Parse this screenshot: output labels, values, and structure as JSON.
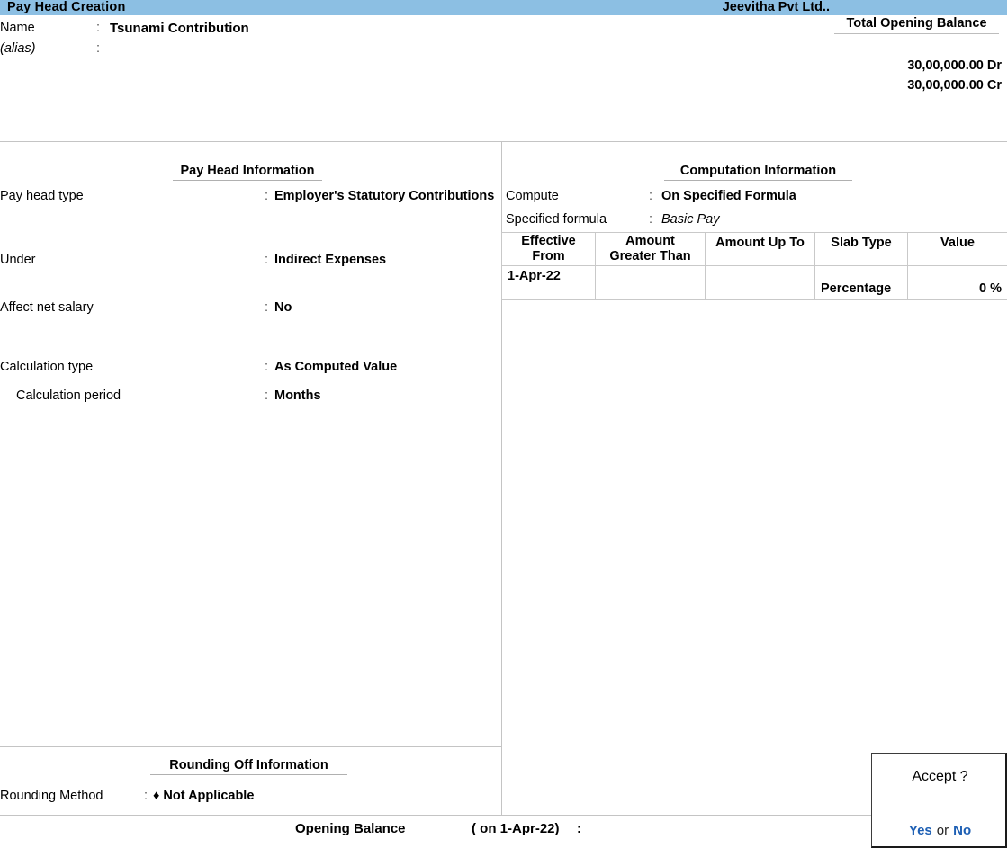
{
  "titlebar": {
    "screen_title": "Pay Head  Creation",
    "company_name": "Jeevitha Pvt Ltd.."
  },
  "header": {
    "name_label": "Name",
    "name_colon": ":",
    "name_value": "Tsunami Contribution",
    "alias_label": "(alias)",
    "alias_colon": ":",
    "alias_value": ""
  },
  "total_opening_balance": {
    "title": "Total Opening Balance",
    "debit": "30,00,000.00 Dr",
    "credit": "30,00,000.00 Cr"
  },
  "pay_head_information": {
    "section_title": "Pay Head Information",
    "rows": [
      {
        "label": "Pay head type",
        "colon": ":",
        "value": "Employer's Statutory Contributions"
      },
      {
        "label": "Under",
        "colon": ":",
        "value": "Indirect Expenses"
      },
      {
        "label": "Affect net salary",
        "colon": ":",
        "value": "No"
      },
      {
        "label": "Calculation type",
        "colon": ":",
        "value": "As Computed Value"
      },
      {
        "label": "Calculation period",
        "colon": ":",
        "value": "Months"
      }
    ]
  },
  "computation_information": {
    "section_title": "Computation Information",
    "rows": [
      {
        "label": "Compute",
        "colon": ":",
        "value": "On Specified Formula"
      },
      {
        "label": "Specified formula",
        "colon": ":",
        "value": "Basic Pay"
      }
    ],
    "slab_table": {
      "columns": [
        "Effective From",
        "Amount Greater Than",
        "Amount Up To",
        "Slab Type",
        "Value"
      ],
      "column_lines": [
        [
          "Effective",
          "From"
        ],
        [
          "Amount",
          "Greater Than"
        ],
        [
          "Amount Up To",
          ""
        ],
        [
          "Slab Type",
          ""
        ],
        [
          "Value",
          ""
        ]
      ],
      "rows": [
        {
          "effective_from": "1-Apr-22",
          "amount_greater_than": "",
          "amount_up_to": "",
          "slab_type": "Percentage",
          "value": "0 %"
        }
      ]
    }
  },
  "rounding_off_information": {
    "section_title": "Rounding Off Information",
    "rows": [
      {
        "label": "Rounding Method",
        "colon": ":",
        "value": "♦ Not Applicable"
      }
    ]
  },
  "bottom_bar": {
    "opening_balance_label": "Opening Balance",
    "on_date": "( on 1-Apr-22)",
    "colon": ":"
  },
  "accept_dialog": {
    "title": "Accept ?",
    "yes": "Yes",
    "or": "or",
    "no": "No"
  },
  "colors": {
    "titlebar_bg": "#8cbfe3",
    "link_blue": "#1d5fb4",
    "divider": "#c4c4c4",
    "page_bg": "#ffffff"
  }
}
